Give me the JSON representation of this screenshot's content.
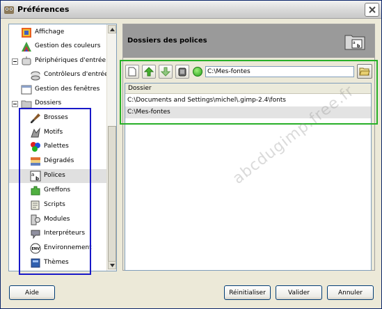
{
  "window": {
    "title": "Préférences"
  },
  "tree": {
    "items": [
      {
        "label": "Affichage",
        "icon": "display-icon"
      },
      {
        "label": "Gestion des couleurs",
        "icon": "color-management-icon"
      },
      {
        "label": "Périphériques d'entrée",
        "icon": "input-devices-icon"
      },
      {
        "label": "Contrôleurs d'entrée",
        "icon": "input-controllers-icon"
      },
      {
        "label": "Gestion des fenêtres",
        "icon": "window-management-icon"
      },
      {
        "label": "Dossiers",
        "icon": "folders-icon"
      },
      {
        "label": "Brosses",
        "icon": "brushes-icon"
      },
      {
        "label": "Motifs",
        "icon": "patterns-icon"
      },
      {
        "label": "Palettes",
        "icon": "palettes-icon"
      },
      {
        "label": "Dégradés",
        "icon": "gradients-icon"
      },
      {
        "label": "Polices",
        "icon": "fonts-icon",
        "selected": true
      },
      {
        "label": "Greffons",
        "icon": "plugins-icon"
      },
      {
        "label": "Scripts",
        "icon": "scripts-icon"
      },
      {
        "label": "Modules",
        "icon": "modules-icon"
      },
      {
        "label": "Interpréteurs",
        "icon": "interpreters-icon"
      },
      {
        "label": "Environnement",
        "icon": "environment-icon"
      },
      {
        "label": "Thèmes",
        "icon": "themes-icon"
      }
    ]
  },
  "panel": {
    "title": "Dossiers des polices",
    "path_value": "C:\\Mes-fontes",
    "column_header": "Dossier",
    "rows": [
      "C:\\Documents and Settings\\michel\\.gimp-2.4\\fonts",
      "C:\\Mes-fontes"
    ]
  },
  "buttons": {
    "help": "Aide",
    "reset": "Réinitialiser",
    "ok": "Valider",
    "cancel": "Annuler"
  },
  "watermark": "abcdugimp.free.fr",
  "colors": {
    "highlight_blue": "#1818c8",
    "highlight_green": "#28b028",
    "header_gray": "#9a9a9a"
  }
}
